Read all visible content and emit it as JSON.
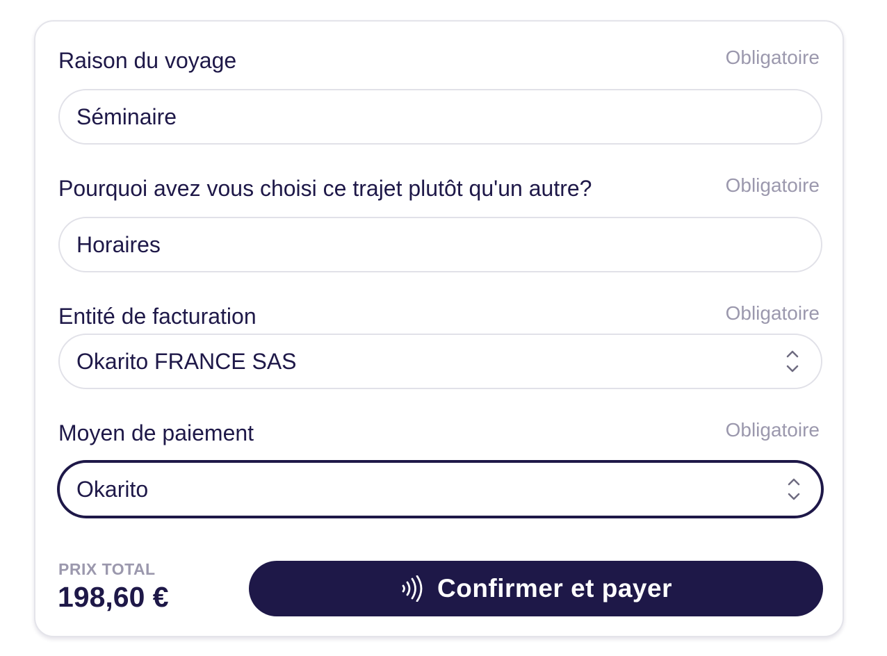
{
  "form": {
    "fields": [
      {
        "label": "Raison du voyage",
        "required_text": "Obligatoire",
        "value": "Séminaire",
        "type": "text"
      },
      {
        "label": "Pourquoi avez vous choisi ce trajet plutôt qu'un autre?",
        "required_text": "Obligatoire",
        "value": "Horaires",
        "type": "text"
      },
      {
        "label": "Entité de facturation",
        "required_text": "Obligatoire",
        "value": "Okarito FRANCE SAS",
        "type": "select",
        "icon": "chevron-up-down-icon"
      },
      {
        "label": "Moyen de paiement",
        "required_text": "Obligatoire",
        "value": "Okarito",
        "type": "select",
        "focused": true,
        "icon": "chevron-up-down-icon"
      }
    ]
  },
  "footer": {
    "total_label": "PRIX TOTAL",
    "total_value": "198,60 €",
    "pay_button": {
      "label": "Confirmer et payer",
      "icon": "contactless-icon"
    }
  },
  "colors": {
    "primary": "#1e1848",
    "muted": "#9b98ad",
    "border": "#e1e1e8",
    "background": "#ffffff"
  }
}
